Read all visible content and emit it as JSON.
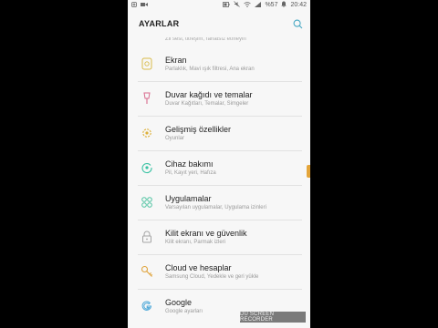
{
  "status_bar": {
    "battery": "%57",
    "time": "20:42",
    "left_icons": [
      "instagram-icon",
      "video-icon"
    ],
    "right_icons": [
      "battery-icon",
      "mute-icon",
      "wifi-icon",
      "signal-icon",
      "notifications-icon"
    ]
  },
  "header": {
    "title": "AYARLAR",
    "search_icon": "search-icon"
  },
  "partial_item_subtitle": "Zil sesi, titreşim, rahatsız etmeyin",
  "items": [
    {
      "title": "Ekran",
      "subtitle": "Parlaklık, Mavi ışık filtresi, Ana ekran",
      "icon": "display-icon",
      "color": "#d8bb4a"
    },
    {
      "title": "Duvar kağıdı ve temalar",
      "subtitle": "Duvar Kağıtları, Temalar, Simgeler",
      "icon": "wallpaper-icon",
      "color": "#d86b8e"
    },
    {
      "title": "Gelişmiş özellikler",
      "subtitle": "Oyunlar",
      "icon": "advanced-features-icon",
      "color": "#ddb13b"
    },
    {
      "title": "Cihaz bakımı",
      "subtitle": "Pil, Kayıt yeri, Hafıza",
      "icon": "device-care-icon",
      "color": "#39c2a3"
    },
    {
      "title": "Uygulamalar",
      "subtitle": "Varsayılan uygulamalar, Uygulama izinleri",
      "icon": "apps-icon",
      "color": "#4fc3a1"
    },
    {
      "title": "Kilit ekranı ve güvenlik",
      "subtitle": "Kilit ekranı, Parmak izleri",
      "icon": "lock-icon",
      "color": "#a4a4a4"
    },
    {
      "title": "Cloud ve hesaplar",
      "subtitle": "Samsung Cloud, Yedekle ve geri yükle",
      "icon": "key-icon",
      "color": "#e0a53e"
    },
    {
      "title": "Google",
      "subtitle": "Google ayarları",
      "icon": "google-icon",
      "color": "#4aa7d8"
    }
  ],
  "watermark": "DU SCREEN RECORDER"
}
